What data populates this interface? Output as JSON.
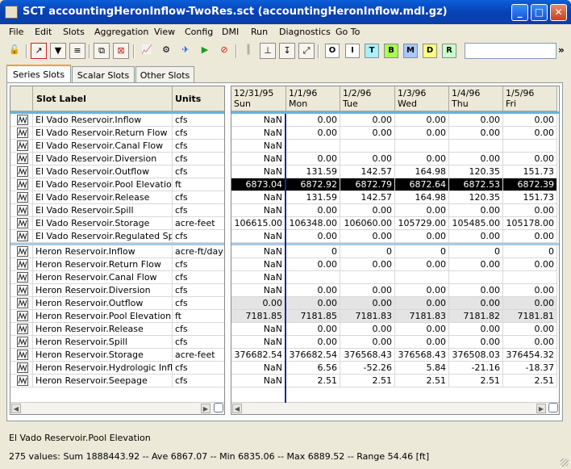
{
  "window": {
    "title": "SCT accountingHeronInflow-TwoRes.sct (accountingHeronInflow.mdl.gz)"
  },
  "menu": [
    "File",
    "Edit",
    "Slots",
    "Aggregation",
    "View",
    "Config",
    "DMI",
    "Run",
    "Diagnostics",
    "Go To"
  ],
  "toolbar": {
    "letters": [
      "O",
      "I",
      "T",
      "B",
      "M",
      "D",
      "R"
    ],
    "letter_colors": [
      "#ffffff",
      "#ffffff",
      "#a8f0ff",
      "#a8ff50",
      "#a8c8ff",
      "#ffff80",
      "#c8ffc8"
    ],
    "search_value": "",
    "more": "»"
  },
  "tabs": [
    "Series Slots",
    "Scalar Slots",
    "Other Slots"
  ],
  "table": {
    "headers": {
      "label": "Slot Label",
      "units": "Units"
    },
    "columns": [
      {
        "date": "12/31/95",
        "day": "Sun"
      },
      {
        "date": "1/1/96",
        "day": "Mon"
      },
      {
        "date": "1/2/96",
        "day": "Tue"
      },
      {
        "date": "1/3/96",
        "day": "Wed"
      },
      {
        "date": "1/4/96",
        "day": "Thu"
      },
      {
        "date": "1/5/96",
        "day": "Fri"
      }
    ],
    "rows": [
      {
        "label": "El Vado Reservoir.Inflow",
        "units": "cfs",
        "values": [
          "NaN",
          "0.00",
          "0.00",
          "0.00",
          "0.00",
          "0.00"
        ]
      },
      {
        "label": "El Vado Reservoir.Return Flow",
        "units": "cfs",
        "values": [
          "NaN",
          "0.00",
          "0.00",
          "0.00",
          "0.00",
          "0.00"
        ]
      },
      {
        "label": "El Vado Reservoir.Canal Flow",
        "units": "cfs",
        "values": [
          "NaN",
          "",
          "",
          "",
          "",
          ""
        ]
      },
      {
        "label": "El Vado Reservoir.Diversion",
        "units": "cfs",
        "values": [
          "NaN",
          "0.00",
          "0.00",
          "0.00",
          "0.00",
          "0.00"
        ]
      },
      {
        "label": "El Vado Reservoir.Outflow",
        "units": "cfs",
        "values": [
          "NaN",
          "131.59",
          "142.57",
          "164.98",
          "120.35",
          "151.73"
        ]
      },
      {
        "label": "El Vado Reservoir.Pool Elevation",
        "units": "ft",
        "values": [
          "6873.04",
          "6872.92",
          "6872.79",
          "6872.64",
          "6872.53",
          "6872.39"
        ],
        "selected": true
      },
      {
        "label": "El Vado Reservoir.Release",
        "units": "cfs",
        "values": [
          "NaN",
          "131.59",
          "142.57",
          "164.98",
          "120.35",
          "151.73"
        ]
      },
      {
        "label": "El Vado Reservoir.Spill",
        "units": "cfs",
        "values": [
          "NaN",
          "0.00",
          "0.00",
          "0.00",
          "0.00",
          "0.00"
        ]
      },
      {
        "label": "El Vado Reservoir.Storage",
        "units": "acre-feet",
        "values": [
          "106615.00",
          "106348.00",
          "106060.00",
          "105729.00",
          "105485.00",
          "105178.00"
        ]
      },
      {
        "label": "El Vado Reservoir.Regulated Spill",
        "units": "cfs",
        "values": [
          "NaN",
          "0.00",
          "0.00",
          "0.00",
          "0.00",
          "0.00"
        ]
      },
      {
        "label": "Heron Reservoir.Inflow",
        "units": "acre-ft/day",
        "values": [
          "NaN",
          "0",
          "0",
          "0",
          "0",
          "0"
        ]
      },
      {
        "label": "Heron Reservoir.Return Flow",
        "units": "cfs",
        "values": [
          "NaN",
          "0.00",
          "0.00",
          "0.00",
          "0.00",
          "0.00"
        ]
      },
      {
        "label": "Heron Reservoir.Canal Flow",
        "units": "cfs",
        "values": [
          "NaN",
          "",
          "",
          "",
          "",
          ""
        ]
      },
      {
        "label": "Heron Reservoir.Diversion",
        "units": "cfs",
        "values": [
          "NaN",
          "0.00",
          "0.00",
          "0.00",
          "0.00",
          "0.00"
        ]
      },
      {
        "label": "Heron Reservoir.Outflow",
        "units": "cfs",
        "values": [
          "0.00",
          "0.00",
          "0.00",
          "0.00",
          "0.00",
          "0.00"
        ],
        "shaded": true
      },
      {
        "label": "Heron Reservoir.Pool Elevation",
        "units": "ft",
        "values": [
          "7181.85",
          "7181.85",
          "7181.83",
          "7181.83",
          "7181.82",
          "7181.81"
        ],
        "shaded": true
      },
      {
        "label": "Heron Reservoir.Release",
        "units": "cfs",
        "values": [
          "NaN",
          "0.00",
          "0.00",
          "0.00",
          "0.00",
          "0.00"
        ]
      },
      {
        "label": "Heron Reservoir.Spill",
        "units": "cfs",
        "values": [
          "NaN",
          "0.00",
          "0.00",
          "0.00",
          "0.00",
          "0.00"
        ]
      },
      {
        "label": "Heron Reservoir.Storage",
        "units": "acre-feet",
        "values": [
          "376682.54",
          "376682.54",
          "376568.43",
          "376568.43",
          "376508.03",
          "376454.32"
        ]
      },
      {
        "label": "Heron Reservoir.Hydrologic Inflow",
        "units": "cfs",
        "values": [
          "NaN",
          "6.56",
          "-52.26",
          "5.84",
          "-21.16",
          "-18.37"
        ]
      },
      {
        "label": "Heron Reservoir.Seepage",
        "units": "cfs",
        "values": [
          "NaN",
          "2.51",
          "2.51",
          "2.51",
          "2.51",
          "2.51"
        ]
      }
    ]
  },
  "status": {
    "slot": "El Vado Reservoir.Pool Elevation",
    "summary": "275 values:  Sum 1888443.92 -- Ave 6867.07 -- Min 6835.06 -- Max 6889.52 -- Range 54.46 [ft]"
  }
}
